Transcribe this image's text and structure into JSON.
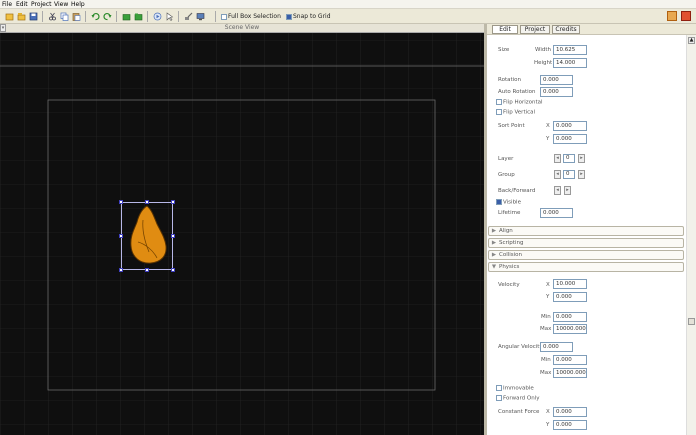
{
  "menu": [
    "File",
    "Edit",
    "Project",
    "View",
    "Help"
  ],
  "toolbar": {
    "fullbox_label": "Full Box Selection",
    "snap_label": "Snap to Grid",
    "fullbox_checked": false,
    "snap_checked": true
  },
  "scene": {
    "title": "Scene View"
  },
  "tabs": {
    "edit": "Edit",
    "project": "Project",
    "credits": "Credits"
  },
  "props": {
    "size_label": "Size",
    "width_label": "Width",
    "width": "10.625",
    "height_label": "Height",
    "height": "14.000",
    "rotation_label": "Rotation",
    "rotation": "0.000",
    "auto_rotation_label": "Auto Rotation",
    "auto_rotation": "0.000",
    "flip_h_label": "Flip Horizontal",
    "flip_v_label": "Flip Vertical",
    "sort_point_label": "Sort Point",
    "x_label": "X",
    "y_label": "Y",
    "sort_x": "0.000",
    "sort_y": "0.000",
    "layer_label": "Layer",
    "layer": "0",
    "group_label": "Group",
    "group": "0",
    "back_forward_label": "Back/Forward",
    "visible_label": "Visible",
    "lifetime_label": "Lifetime",
    "lifetime": "0.000"
  },
  "sections": {
    "align": "Align",
    "scripting": "Scripting",
    "collision": "Collision",
    "physics": "Physics"
  },
  "physics": {
    "velocity_label": "Velocity",
    "vel_x": "10.000",
    "vel_y": "0.000",
    "min_label": "Min",
    "max_label": "Max",
    "vel_min": "0.000",
    "vel_max": "10000.000",
    "ang_vel_label": "Angular Velocity",
    "ang_vel": "0.000",
    "ang_min": "0.000",
    "ang_max": "10000.000",
    "immovable_label": "Immovable",
    "forward_only_label": "Forward Only",
    "const_force_label": "Constant Force",
    "force_x": "0.000",
    "force_y": "0.000"
  }
}
